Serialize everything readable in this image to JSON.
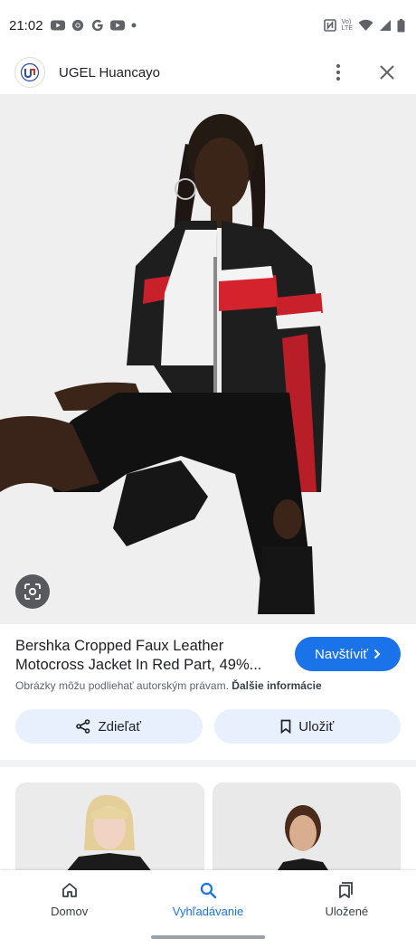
{
  "status_bar": {
    "time": "21:02",
    "left_icons": [
      "youtube-icon",
      "chrome-icon",
      "google-icon",
      "youtube-icon",
      "dot-icon"
    ],
    "right_icons": [
      "nfc-icon",
      "volte-icon",
      "wifi-icon",
      "signal-icon",
      "battery-icon"
    ],
    "volte_line1": "Vo)",
    "volte_line2": "LTE"
  },
  "header": {
    "site_name": "UGEL Huancayo",
    "more_icon": "more-vert-icon",
    "close_icon": "close-icon"
  },
  "product": {
    "title": "Bershka Cropped Faux Leather Motocross Jacket In Red Part, 49%...",
    "visit_label": "Navštíviť",
    "copyright_text": "Obrázky môžu podliehať autorským právam.",
    "more_info_label": "Ďalšie informácie",
    "share_label": "Zdieľať",
    "save_label": "Uložiť"
  },
  "bottom_nav": {
    "items": [
      {
        "label": "Domov",
        "icon": "home-icon"
      },
      {
        "label": "Vyhľadávanie",
        "icon": "search-icon"
      },
      {
        "label": "Uložené",
        "icon": "collections-icon"
      }
    ]
  },
  "colors": {
    "accent": "#1a73e8",
    "tonal_button": "#e8f0fe",
    "text_primary": "#202124",
    "text_secondary": "#5f6368"
  }
}
